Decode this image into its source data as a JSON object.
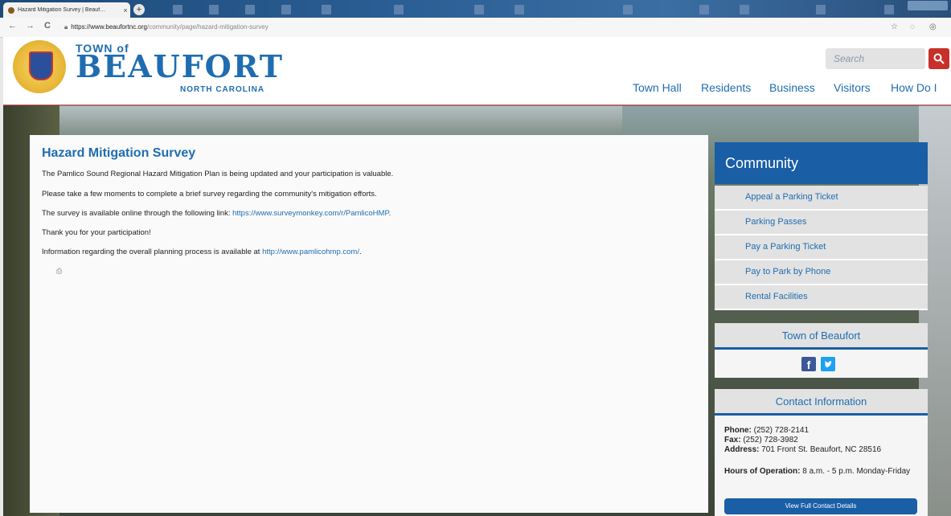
{
  "browser": {
    "tab_title": "Hazard Mitigation Survey | Beauf…",
    "tab_close": "×",
    "new_tab": "+",
    "back": "←",
    "forward": "→",
    "reload": "C",
    "url_host": "https://www.beaufortnc.org",
    "url_path": "/community/page/hazard-mitigation-survey",
    "star": "☆"
  },
  "header": {
    "logo_town": "TOWN of",
    "logo_name": "BEAUFORT",
    "logo_state": "NORTH CAROLINA",
    "search_placeholder": "Search",
    "nav": [
      "Town Hall",
      "Residents",
      "Business",
      "Visitors",
      "How Do I"
    ]
  },
  "main": {
    "title": "Hazard Mitigation Survey",
    "p1": "The Pamlico Sound Regional Hazard Mitigation Plan is being updated and your participation is valuable.",
    "p2": "Please take a few moments to complete a brief survey regarding the community's mitigation efforts.",
    "p3_text": "The survey is available online through the following link: ",
    "p3_link": "https://www.surveymonkey.com/r/PamlicoHMP",
    "p3_end": ".",
    "p4": "Thank you for your participation!",
    "p5_text": "Information regarding the overall planning process is available at ",
    "p5_link": "http://www.pamlicohmp.com/",
    "p5_end": "."
  },
  "sidebar": {
    "community_title": "Community",
    "links": [
      "Appeal a Parking Ticket",
      "Parking Passes",
      "Pay a Parking Ticket",
      "Pay to Park by Phone",
      "Rental Facilities"
    ],
    "social_title": "Town of Beaufort",
    "contact_title": "Contact Information",
    "phone_label": "Phone:",
    "phone": " (252) 728-2141",
    "fax_label": "Fax:",
    "fax": " (252) 728-3982",
    "address_label": "Address:",
    "address": " 701 Front St. Beaufort, NC 28516",
    "hours_label": "Hours of Operation:",
    "hours": " 8 a.m. - 5 p.m. Monday-Friday",
    "full_button": "View Full Contact Details"
  },
  "colors": {
    "brand_blue": "#1f6db0",
    "accent_red": "#c8302a",
    "sidebar_blue": "#1a5ea6"
  }
}
